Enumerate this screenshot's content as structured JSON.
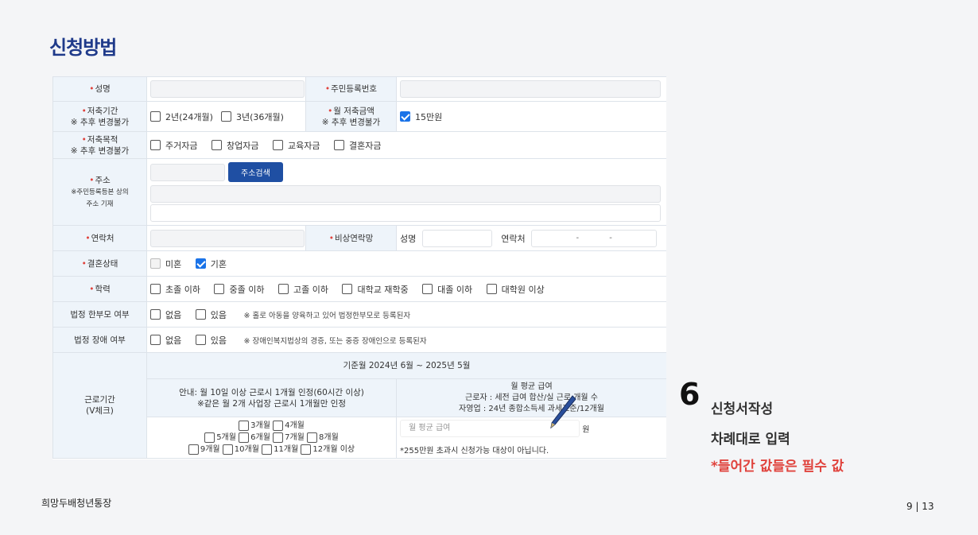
{
  "title": "신청방법",
  "form": {
    "name_label": "성명",
    "rrn_label": "주민등록번호",
    "period_label": "저축기간",
    "period_note": "※ 추후 변경불가",
    "period_opt1": "2년(24개월)",
    "period_opt2": "3년(36개월)",
    "amount_label": "월 저축금액",
    "amount_note": "※ 추후 변경불가",
    "amount_opt": "15만원",
    "purpose_label": "저축목적",
    "purpose_note": "※ 추후 변경불가",
    "purpose_opts": [
      "주거자금",
      "창업자금",
      "교육자금",
      "결혼자금"
    ],
    "address_label": "주소",
    "address_note1": "※주민등록등본 상의",
    "address_note2": "주소 기재",
    "address_search_button": "주소검색",
    "contact_label": "연락처",
    "emergency_label": "비상연락망",
    "emergency_name": "성명",
    "emergency_contact": "연락처",
    "phone_dash": "-",
    "marriage_label": "결혼상태",
    "marriage_opts": [
      "미혼",
      "기혼"
    ],
    "education_label": "학력",
    "education_opts": [
      "초졸 이하",
      "중졸 이하",
      "고졸 이하",
      "대학교 재학중",
      "대졸 이하",
      "대학원 이상"
    ],
    "single_parent_label": "법정 한부모 여부",
    "single_parent_opts": [
      "없음",
      "있음"
    ],
    "single_parent_note": "※ 홀로 아동을 양육하고 있어 법정한부모로 등록된자",
    "disability_label": "법정 장애 여부",
    "disability_opts": [
      "없음",
      "있음"
    ],
    "disability_note": "※ 장애인복지법상의 경증, 또는 중증 장애인으로 등록된자",
    "work_label": "근로기간",
    "work_sub": "(V체크)",
    "base_month": "기준월 2024년 6월 ~ 2025년 5월",
    "guide_line1": "안내: 월 10일 이상 근로시 1개월 인정(60시간 이상)",
    "guide_line2": "※같은 월 2개 사업장 근로시 1개월만 인정",
    "avg_title": "월 평균 급여",
    "avg_line1": "근로자 : 세전 급여 합산/실 근로 개월 수",
    "avg_line2": "자영업 : 24년 종합소득세 과세표준/12개월",
    "months_row1": [
      "3개월",
      "4개월"
    ],
    "months_row2": [
      "5개월",
      "6개월",
      "7개월",
      "8개월"
    ],
    "months_row3": [
      "9개월",
      "10개월",
      "11개월",
      "12개월 이상"
    ],
    "avg_placeholder": "월 평균 급여",
    "won": "원",
    "avg_warning": "*255만원 초과시 신청가능 대상이 아닙니다."
  },
  "step": {
    "number": "6",
    "title": "신청서작성",
    "line2": "차례대로 입력",
    "line3": "*들어간 값들은 필수 값"
  },
  "footer": {
    "left": "희망두배청년통장",
    "page": "9 | 13"
  },
  "colors": {
    "title": "#1f3a8a",
    "accent": "#e0433d",
    "checkbox": "#1a73e8",
    "button": "#1f4fa3"
  }
}
